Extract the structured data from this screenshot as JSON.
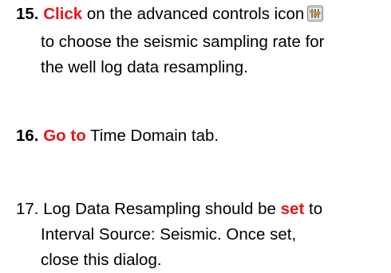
{
  "steps": [
    {
      "number": "15.",
      "action": "Click",
      "line1_rest": "on the advanced controls icon",
      "icon": "advanced-controls-icon",
      "line2": "to choose the seismic sampling rate for",
      "line3": "the well log data resampling."
    },
    {
      "number": "16.",
      "action": "Go to",
      "line1_rest": "Time Domain tab."
    },
    {
      "number": "17.",
      "line1_before": "Log Data Resampling should be",
      "action": "set",
      "line1_after": "to",
      "line2": "Interval Source: Seismic. Once set,",
      "line3": "close this dialog."
    }
  ],
  "colors": {
    "action": "#e8141b",
    "text": "#000000"
  }
}
